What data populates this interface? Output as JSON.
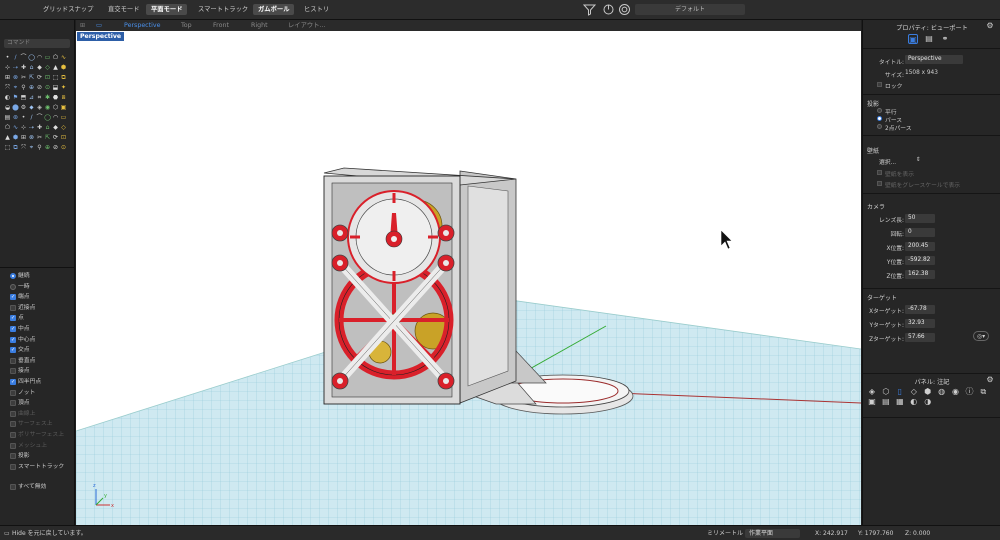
{
  "toolbar": {
    "buttons": [
      {
        "label": "グリッドスナップ",
        "on": false
      },
      {
        "label": "直交モード",
        "on": false
      },
      {
        "label": "平面モード",
        "on": true
      },
      {
        "label": "スマートトラック",
        "on": false
      },
      {
        "label": "ガムボール",
        "on": true
      },
      {
        "label": "ヒストリ",
        "on": false
      }
    ],
    "display_mode": "デフォルト"
  },
  "left_panel": {
    "command_placeholder": "コマンド",
    "snaps": {
      "mode_options": [
        "継続",
        "一時"
      ],
      "mode_selected": 0,
      "items": [
        {
          "label": "端点",
          "checked": true,
          "enabled": true
        },
        {
          "label": "近接点",
          "checked": false,
          "enabled": true
        },
        {
          "label": "点",
          "checked": true,
          "enabled": true
        },
        {
          "label": "中点",
          "checked": true,
          "enabled": true
        },
        {
          "label": "中心点",
          "checked": true,
          "enabled": true
        },
        {
          "label": "交点",
          "checked": true,
          "enabled": true
        },
        {
          "label": "垂直点",
          "checked": false,
          "enabled": true
        },
        {
          "label": "接点",
          "checked": false,
          "enabled": true
        },
        {
          "label": "四半円点",
          "checked": true,
          "enabled": true
        },
        {
          "label": "ノット",
          "checked": false,
          "enabled": true
        },
        {
          "label": "頂点",
          "checked": false,
          "enabled": true
        },
        {
          "label": "曲線上",
          "checked": false,
          "enabled": false
        },
        {
          "label": "サーフェス上",
          "checked": false,
          "enabled": false
        },
        {
          "label": "ポリサーフェス上",
          "checked": false,
          "enabled": false
        },
        {
          "label": "メッシュ上",
          "checked": false,
          "enabled": false
        },
        {
          "label": "投影",
          "checked": false,
          "enabled": true
        },
        {
          "label": "スマートトラック",
          "checked": false,
          "enabled": true
        }
      ],
      "disable_all_label": "すべて無効"
    }
  },
  "viewport_tabs": [
    "Perspective",
    "Top",
    "Front",
    "Right",
    "レイアウト..."
  ],
  "viewport_tab_active": 0,
  "viewport_label": "Perspective",
  "right_panel": {
    "title": "プロパティ: ビューポート",
    "title_label": "タイトル:",
    "title_value": "Perspective",
    "size_label": "サイズ:",
    "size_value": "1508 x 943",
    "lock_label": "ロック",
    "projection_section": "投影",
    "projection_options": [
      "平行",
      "パース",
      "2点パース"
    ],
    "projection_selected": 1,
    "wallpaper_section": "壁紙",
    "wallpaper_select": "選択...",
    "wallpaper_show": "壁紙を表示",
    "wallpaper_gray": "壁紙をグレースケールで表示",
    "camera_section": "カメラ",
    "camera_fields": [
      {
        "label": "レンズ長:",
        "value": "50"
      },
      {
        "label": "回転:",
        "value": "0"
      },
      {
        "label": "X位置:",
        "value": "200.45"
      },
      {
        "label": "Y位置:",
        "value": "-592.82"
      },
      {
        "label": "Z位置:",
        "value": "162.38"
      }
    ],
    "target_section": "ターゲット",
    "target_fields": [
      {
        "label": "Xターゲット:",
        "value": "-67.78"
      },
      {
        "label": "Yターゲット:",
        "value": "32.93"
      },
      {
        "label": "Zターゲット:",
        "value": "57.66"
      }
    ],
    "panel2_title": "パネル: 注記"
  },
  "status_bar": {
    "message": "Hide を元に戻しています。",
    "units": "ミリメートル",
    "cplane": "作業平面",
    "x": "X: 242.917",
    "y": "Y: 1797.760",
    "z": "Z: 0.000"
  },
  "colors": {
    "accent": "#3a7de0",
    "model_red": "#d9202a",
    "model_gray": "#d4d4d4",
    "model_gold": "#c9a227",
    "grid": "#9fd0df",
    "viewport_bg": "#ffffff"
  }
}
